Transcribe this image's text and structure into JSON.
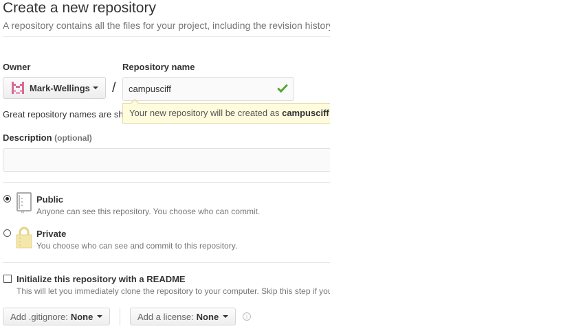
{
  "header": {
    "title": "Create a new repository",
    "subtitle": "A repository contains all the files for your project, including the revision history."
  },
  "owner": {
    "label": "Owner",
    "value": "Mark-Wellings",
    "avatar_color": "#d96a96"
  },
  "separator": "/",
  "repo_name": {
    "label": "Repository name",
    "value": "campusciff",
    "valid_color": "#55a532"
  },
  "hint": {
    "text": "Great repository names are short and memorable.",
    "tooltip_prefix": "Your new repository will be created as ",
    "tooltip_name": "campusciff"
  },
  "description": {
    "label": "Description",
    "optional": "(optional)",
    "value": ""
  },
  "visibility": {
    "public": {
      "title": "Public",
      "desc": "Anyone can see this repository. You choose who can commit.",
      "checked": true,
      "icon": "book-icon"
    },
    "private": {
      "title": "Private",
      "desc": "You choose who can see and commit to this repository.",
      "checked": false,
      "icon": "lock-icon"
    }
  },
  "init": {
    "title": "Initialize this repository with a README",
    "desc": "This will let you immediately clone the repository to your computer. Skip this step if you're importing an existing repository."
  },
  "gitignore": {
    "label": "Add .gitignore:",
    "value": "None"
  },
  "license": {
    "label": "Add a license:",
    "value": "None"
  },
  "info_icon": "i"
}
